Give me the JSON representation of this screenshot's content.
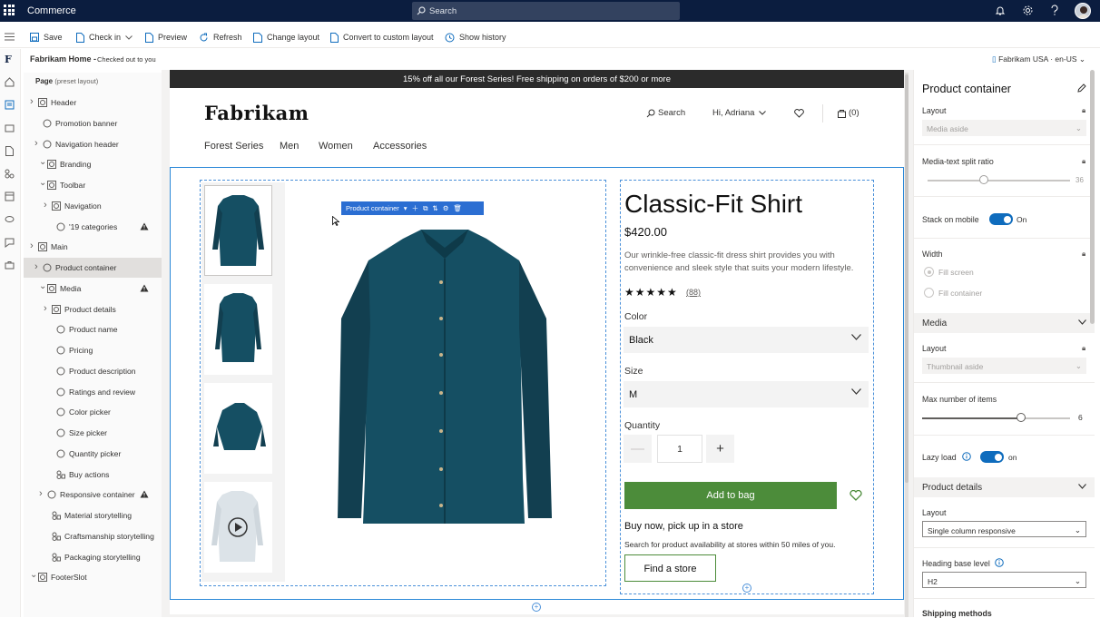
{
  "app": {
    "name": "Commerce",
    "search_placeholder": "Search"
  },
  "commands": [
    {
      "label": "Save",
      "icon": "save-icon"
    },
    {
      "label": "Check in",
      "icon": "check-in-icon",
      "has_dropdown": true
    },
    {
      "label": "Preview",
      "icon": "preview-icon"
    },
    {
      "label": "Refresh",
      "icon": "refresh-icon"
    },
    {
      "label": "Change layout",
      "icon": "change-layout-icon"
    },
    {
      "label": "Convert to custom layout",
      "icon": "convert-icon"
    },
    {
      "label": "Show history",
      "icon": "history-icon"
    }
  ],
  "page": {
    "name": "Fabrikam Home -",
    "status": "Checked out to you",
    "locale": "Fabrikam USA · en-US"
  },
  "tree": {
    "root_label": "Page",
    "root_sub": "(preset layout)",
    "nodes": [
      {
        "label": "Header",
        "expand": "right",
        "icon": "box"
      },
      {
        "label": "Promotion banner",
        "icon": "circle"
      },
      {
        "label": "Navigation header",
        "expand": "right",
        "icon": "circle"
      },
      {
        "label": "Branding",
        "expand": "down",
        "icon": "box"
      },
      {
        "label": "Toolbar",
        "expand": "down",
        "icon": "box"
      },
      {
        "label": "Navigation",
        "expand": "right",
        "icon": "box"
      },
      {
        "label": "'19 categories",
        "icon": "circle",
        "warning": true
      },
      {
        "label": "Main",
        "expand": "right",
        "icon": "box"
      },
      {
        "label": "Product container",
        "expand": "right",
        "icon": "circle",
        "selected": true
      },
      {
        "label": "Media",
        "expand": "down",
        "icon": "box",
        "warning": true
      },
      {
        "label": "Product details",
        "expand": "right",
        "icon": "box"
      },
      {
        "label": "Product name",
        "icon": "circle"
      },
      {
        "label": "Pricing",
        "icon": "circle"
      },
      {
        "label": "Product description",
        "icon": "circle"
      },
      {
        "label": "Ratings and review",
        "icon": "circle"
      },
      {
        "label": "Color picker",
        "icon": "circle"
      },
      {
        "label": "Size picker",
        "icon": "circle"
      },
      {
        "label": "Quantity picker",
        "icon": "circle"
      },
      {
        "label": "Buy actions",
        "icon": "group"
      },
      {
        "label": "Responsive container",
        "expand": "right",
        "icon": "circle",
        "warning": true
      },
      {
        "label": "Material storytelling",
        "icon": "group"
      },
      {
        "label": "Craftsmanship storytelling",
        "icon": "group"
      },
      {
        "label": "Packaging  storytelling",
        "icon": "group"
      },
      {
        "label": "FooterSlot",
        "expand": "down",
        "icon": "box"
      }
    ]
  },
  "site": {
    "promo": "15% off all our Forest Series! Free shipping on orders of $200 or more",
    "logo": "Fabrikam",
    "header_search": "Search",
    "greeting": "Hi, Adriana",
    "cart": "(0)",
    "categories": [
      "Forest Series",
      "Men",
      "Women",
      "Accessories"
    ]
  },
  "container_toolbar": {
    "label": "Product container"
  },
  "product": {
    "title": "Classic-Fit Shirt",
    "price": "$420.00",
    "description": "Our wrinkle-free classic-fit dress shirt provides you with convenience and sleek style that suits your modern lifestyle.",
    "stars": "★★★★★",
    "rating": 4.5,
    "reviews": "(88)",
    "color_label": "Color",
    "color_value": "Black",
    "size_label": "Size",
    "size_value": "M",
    "quantity_label": "Quantity",
    "quantity_value": "1",
    "minus": "—",
    "plus": "+",
    "add_to_bag": "Add to bag",
    "buy_now": "Buy now, pick up in a store",
    "buy_sub": "Search for product availability at stores within 50 miles of you.",
    "find_store": "Find a store",
    "shirt_color": "#154f63"
  },
  "properties": {
    "title": "Product container",
    "layout_label": "Layout",
    "layout_value": "Media aside",
    "split_label": "Media-text split ratio",
    "split_value": "36",
    "stack_label": "Stack on mobile",
    "stack_value": "On",
    "width_label": "Width",
    "width_options": [
      "Fill screen",
      "Fill container"
    ],
    "media_section": "Media",
    "media_layout_label": "Layout",
    "media_layout_value": "Thumbnail aside",
    "max_items_label": "Max number of items",
    "max_items_value": "6",
    "max_items_fraction": 0.67,
    "lazy_label": "Lazy load",
    "lazy_value": "on",
    "details_section": "Product details",
    "details_layout_label": "Layout",
    "details_layout_value": "Single column responsive",
    "heading_label": "Heading base level",
    "heading_value": "H2",
    "shipping_label": "Shipping methods"
  },
  "colors": {
    "topbar": "#0b1d3f",
    "accent": "#0f6cbd",
    "selection": "#2b88d8",
    "add_to_bag": "#4c8c3a"
  }
}
